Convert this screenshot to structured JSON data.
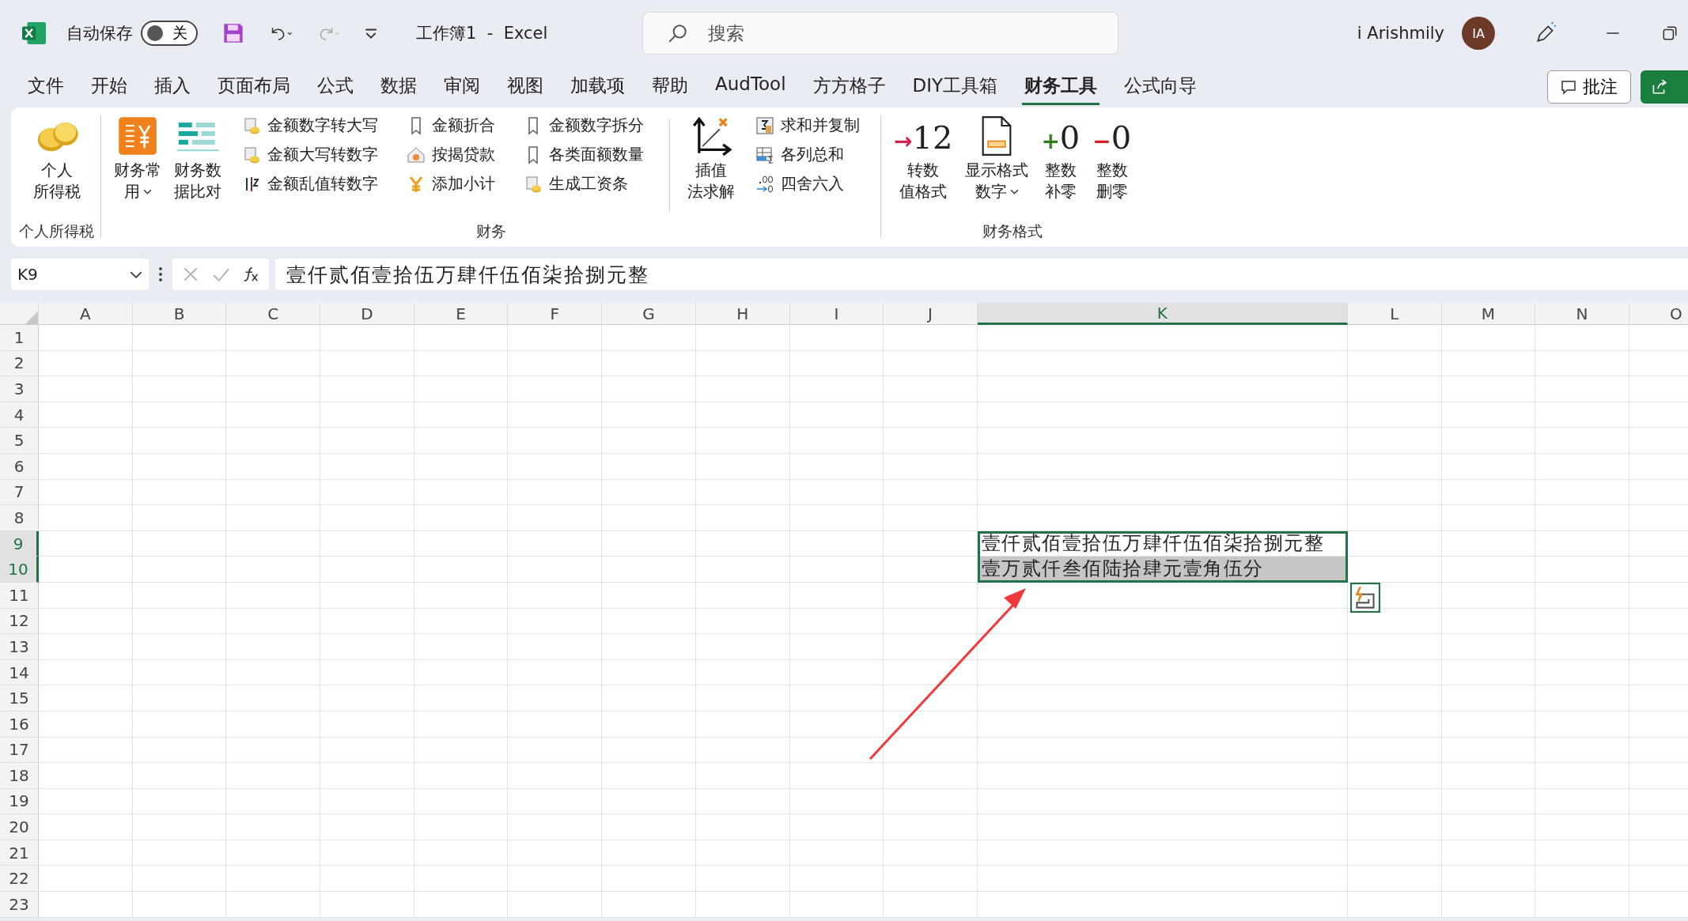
{
  "title_bar": {
    "autosave_label": "自动保存",
    "autosave_toggle": {
      "on": false,
      "label": "关"
    },
    "document_title": "工作簿1  -  Excel",
    "search": {
      "placeholder": "搜索"
    },
    "user_name": "i Arishmily",
    "avatar_initials": "IA"
  },
  "menu_tabs": [
    {
      "label": "文件",
      "selected": false
    },
    {
      "label": "开始",
      "selected": false
    },
    {
      "label": "插入",
      "selected": false
    },
    {
      "label": "页面布局",
      "selected": false
    },
    {
      "label": "公式",
      "selected": false
    },
    {
      "label": "数据",
      "selected": false
    },
    {
      "label": "审阅",
      "selected": false
    },
    {
      "label": "视图",
      "selected": false
    },
    {
      "label": "加载项",
      "selected": false
    },
    {
      "label": "帮助",
      "selected": false
    },
    {
      "label": "AudTool",
      "selected": false
    },
    {
      "label": "方方格子",
      "selected": false
    },
    {
      "label": "DIY工具箱",
      "selected": false
    },
    {
      "label": "财务工具",
      "selected": true
    },
    {
      "label": "公式向导",
      "selected": false
    }
  ],
  "comments_button": "批注",
  "ribbon": {
    "groups": [
      {
        "label": "个人所得税",
        "items": [
          {
            "kind": "large",
            "lines": [
              "个人",
              "所得税"
            ],
            "dropdown": false
          }
        ]
      },
      {
        "label": "财务",
        "items": [
          {
            "kind": "large",
            "lines": [
              "财务常",
              "用"
            ],
            "dropdown": true
          },
          {
            "kind": "large",
            "lines": [
              "财务数",
              "据比对"
            ],
            "dropdown": false
          },
          {
            "kind": "stack",
            "labels": [
              "金额数字转大写",
              "金额大写转数字",
              "金额乱值转数字"
            ]
          },
          {
            "kind": "stack",
            "labels": [
              "金额折合",
              "按揭贷款",
              "添加小计"
            ]
          },
          {
            "kind": "stack",
            "labels": [
              "金额数字拆分",
              "各类面额数量",
              "生成工资条"
            ]
          },
          {
            "kind": "separator"
          },
          {
            "kind": "large",
            "lines": [
              "插值",
              "法求解"
            ],
            "dropdown": false
          },
          {
            "kind": "stack",
            "labels": [
              "求和并复制",
              "各列总和",
              "四舍六入"
            ]
          }
        ]
      },
      {
        "label": "财务格式",
        "items": [
          {
            "kind": "glyph",
            "lines": [
              "转数",
              "值格式"
            ],
            "glyph": {
              "sign": "→",
              "digits": "12",
              "color": "#d6204e"
            }
          },
          {
            "kind": "large",
            "lines": [
              "显示格式",
              "数字"
            ],
            "dropdown": true
          },
          {
            "kind": "glyph",
            "lines": [
              "整数",
              "补零"
            ],
            "glyph": {
              "sign": "+",
              "digits": "0",
              "color": "#2e7d1e"
            }
          },
          {
            "kind": "glyph",
            "lines": [
              "整数",
              "删零"
            ],
            "glyph": {
              "sign": "−",
              "digits": "0",
              "color": "#d42020"
            }
          }
        ]
      }
    ]
  },
  "formula_bar": {
    "name_box": "K9",
    "formula": "壹仟贰佰壹拾伍万肆仟伍佰柒拾捌元整"
  },
  "sheet": {
    "columns": [
      {
        "label": "A",
        "selected": false
      },
      {
        "label": "B",
        "selected": false
      },
      {
        "label": "C",
        "selected": false
      },
      {
        "label": "D",
        "selected": false
      },
      {
        "label": "E",
        "selected": false
      },
      {
        "label": "F",
        "selected": false
      },
      {
        "label": "G",
        "selected": false
      },
      {
        "label": "H",
        "selected": false
      },
      {
        "label": "I",
        "selected": false
      },
      {
        "label": "J",
        "selected": false
      },
      {
        "label": "K",
        "selected": true
      },
      {
        "label": "L",
        "selected": false
      },
      {
        "label": "M",
        "selected": false
      },
      {
        "label": "N",
        "selected": false
      },
      {
        "label": "O",
        "selected": false
      }
    ],
    "rows": [
      {
        "label": "1",
        "selected": false
      },
      {
        "label": "2",
        "selected": false
      },
      {
        "label": "3",
        "selected": false
      },
      {
        "label": "4",
        "selected": false
      },
      {
        "label": "5",
        "selected": false
      },
      {
        "label": "6",
        "selected": false
      },
      {
        "label": "7",
        "selected": false
      },
      {
        "label": "8",
        "selected": false
      },
      {
        "label": "9",
        "selected": true,
        "column_k": {
          "value": "壹仟贰佰壹拾伍万肆仟伍佰柒拾捌元整",
          "highlighted": false
        }
      },
      {
        "label": "10",
        "selected": true,
        "column_k": {
          "value": "壹万贰仟叁佰陆拾肆元壹角伍分",
          "highlighted": true
        }
      },
      {
        "label": "11",
        "selected": false
      },
      {
        "label": "12",
        "selected": false
      },
      {
        "label": "13",
        "selected": false
      },
      {
        "label": "14",
        "selected": false
      },
      {
        "label": "15",
        "selected": false
      },
      {
        "label": "16",
        "selected": false
      },
      {
        "label": "17",
        "selected": false
      },
      {
        "label": "18",
        "selected": false
      },
      {
        "label": "19",
        "selected": false
      },
      {
        "label": "20",
        "selected": false
      },
      {
        "label": "21",
        "selected": false
      },
      {
        "label": "22",
        "selected": false
      },
      {
        "label": "23",
        "selected": false
      }
    ]
  }
}
